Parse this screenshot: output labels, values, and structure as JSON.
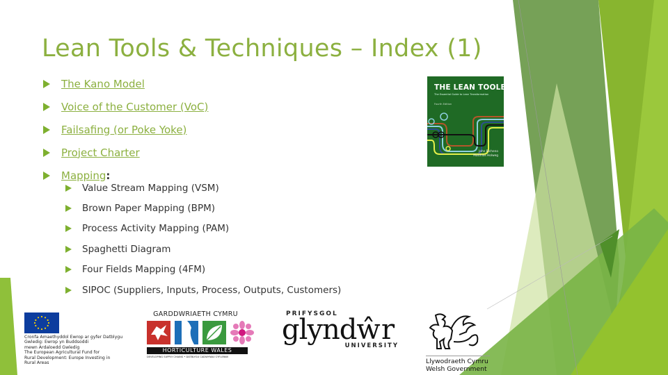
{
  "slide": {
    "title": "Lean Tools & Techniques – Index (1)",
    "items": [
      {
        "label": "The Kano Model",
        "link": true
      },
      {
        "label": "Voice of the Customer (VoC)",
        "link": true
      },
      {
        "label": "Failsafing (or Poke Yoke)",
        "link": true
      },
      {
        "label": "Project Charter",
        "link": true
      },
      {
        "label": "Mapping",
        "link": true,
        "suffix": ":"
      }
    ],
    "subitems": [
      "Value Stream Mapping (VSM)",
      "Brown Paper Mapping (BPM)",
      "Process Activity Mapping (PAM)",
      "Spaghetti Diagram",
      "Four Fields Mapping (4FM)",
      "SIPOC (Suppliers, Inputs, Process, Outputs, Customers)"
    ]
  },
  "book": {
    "title": "THE LEAN TOOLBOX",
    "subtitle": "The Essential Guide to Lean Transformation",
    "edition": "Fourth Edition",
    "author1": "John Bicheno",
    "author2": "Matthias Holweg"
  },
  "logos": {
    "eu": {
      "text": "Cronfa Amaethyddol Ewrop ar gyfer Datblygu\nGwledig: Ewrop yn Buddsoddi\nmewn Ardaloedd Gwledig\nThe European Agricultural Fund for\nRural Development: Europe Investing in\nRural Areas"
    },
    "horticulture": {
      "top": "GARDDWRIAETH CYMRU",
      "band": "HORTICULTURE  WALES",
      "foot": "DEVELOPING SUPPLY CHAINS • DATBLYGU CADWYNAU CYFLENWI"
    },
    "glyndwr": {
      "top": "PRIFYSGOL",
      "main": "glyndŵr",
      "bottom": "UNIVERSITY"
    },
    "welsh_gov": {
      "line1": "Llywodraeth Cymru",
      "line2": "Welsh Government"
    }
  },
  "colors": {
    "accent": "#8cb040",
    "bullet": "#7eb02f",
    "body_text": "#333333"
  }
}
